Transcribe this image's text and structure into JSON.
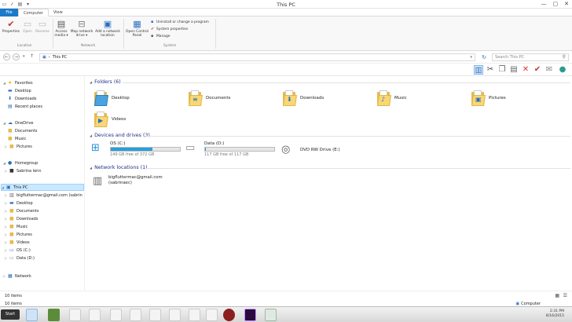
{
  "window": {
    "title": "This PC",
    "controls": {
      "minimize": "—",
      "maximize": "▢",
      "close": "✕"
    }
  },
  "tabs": [
    {
      "label": "File"
    },
    {
      "label": "Computer"
    },
    {
      "label": "View"
    }
  ],
  "ribbon": {
    "buttons": {
      "properties": "Properties",
      "open": "Open",
      "rename": "Rename",
      "access_media": "Access media ▾",
      "map_drive": "Map network drive ▾",
      "add_location": "Add a network location",
      "control_panel": "Open Control Panel"
    },
    "small": {
      "uninstall": "Uninstall or change a program",
      "sys_props": "System properties",
      "manage": "Manage"
    },
    "groups": {
      "location": "Location",
      "network": "Network",
      "system": "System"
    }
  },
  "address": {
    "path_item": "This PC",
    "separator": "›",
    "search_placeholder": "Search This PC"
  },
  "nav": {
    "favorites": "Favorites",
    "fav_items": [
      "Desktop",
      "Downloads",
      "Recent places"
    ],
    "onedrive": "OneDrive",
    "onedrive_items": [
      "Documents",
      "Music",
      "Pictures"
    ],
    "homegroup": "Homegroup",
    "homegroup_items": [
      "Sabrina lenn"
    ],
    "thispc": "This PC",
    "thispc_items": [
      "bigfluttermac@gmail.com (sabrin",
      "Desktop",
      "Documents",
      "Downloads",
      "Music",
      "Pictures",
      "Videos",
      "OS (C:)",
      "Data (D:)"
    ],
    "network": "Network"
  },
  "sections": {
    "folders_header": "Folders (6)",
    "devices_header": "Devices and drives (3)",
    "netloc_header": "Network locations (1)"
  },
  "folders": [
    {
      "name": "Desktop",
      "glyph": ""
    },
    {
      "name": "Documents",
      "glyph": "≡"
    },
    {
      "name": "Downloads",
      "glyph": "⬇"
    },
    {
      "name": "Music",
      "glyph": "♪"
    },
    {
      "name": "Pictures",
      "glyph": "▣"
    },
    {
      "name": "Videos",
      "glyph": "▶"
    }
  ],
  "drives": [
    {
      "name": "OS (C:)",
      "free": "149 GB free of 372 GB",
      "used_fraction": 0.6
    },
    {
      "name": "Data (D:)",
      "free": "117 GB free of 117 GB",
      "used_fraction": 0.01
    },
    {
      "name": "DVD RW Drive (E:)",
      "free": ""
    }
  ],
  "network_location": {
    "line1": "bigfluttermac@gmail.com",
    "line2": "(sabrinaec)"
  },
  "status": {
    "items": "10 items",
    "computer": "Computer"
  },
  "taskbar": {
    "start": "Start",
    "time": "2:31 PM",
    "date": "8/16/2015"
  },
  "colors": {
    "accent": "#1979ca",
    "drive_bar": "#26a0da",
    "section_header": "#1e3287"
  }
}
